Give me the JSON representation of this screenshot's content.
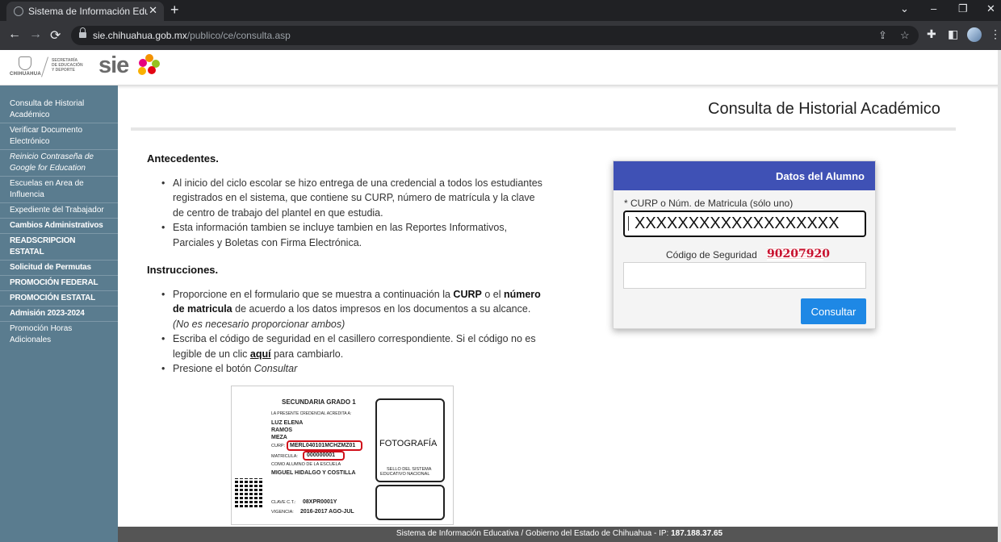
{
  "browser": {
    "tab_title": "Sistema de Información Educativa",
    "tab_close": "✕",
    "new_tab": "+",
    "window_controls": [
      "⌄",
      "–",
      "❐",
      "✕"
    ],
    "back": "←",
    "forward": "→",
    "reload": "⟳",
    "url_host": "sie.chihuahua.gob.mx",
    "url_path": "/publico/ce/consulta.asp",
    "colors": {
      "tabbar": "#202124",
      "toolbar": "#35363a"
    }
  },
  "header": {
    "gov_label": "CHIHUAHUA",
    "secretaria_lines": [
      "SECRETARÍA",
      "DE EDUCACIÓN",
      "Y DEPORTE"
    ],
    "sie_logo": "sie"
  },
  "sidebar": {
    "items": [
      {
        "label": "Consulta de Historial Académico"
      },
      {
        "label": "Verificar Documento Electrónico"
      },
      {
        "label": "Reinicio Contraseña de Google for Education"
      },
      {
        "label": "Escuelas en Area de Influencia"
      },
      {
        "label": "Expediente del Trabajador"
      },
      {
        "label": "Cambios Administrativos"
      },
      {
        "label": "READSCRIPCION ESTATAL"
      },
      {
        "label": "Solicitud de Permutas"
      },
      {
        "label": "PROMOCIÓN FEDERAL"
      },
      {
        "label": "PROMOCIÓN ESTATAL"
      },
      {
        "label": "Admisión 2023-2024"
      },
      {
        "label": "Promoción Horas Adicionales"
      }
    ],
    "color": "#5a7c8f"
  },
  "main": {
    "title": "Consulta de Historial Académico",
    "antecedentes_title": "Antecedentes.",
    "antecedentes": [
      "Al inicio del ciclo escolar se hizo entrega de una credencial a todos los estudiantes registrados en el sistema, que contiene su CURP, número de matrícula y la clave de centro de trabajo del plantel en que estudia.",
      "Esta información tambien se incluye tambien en las Reportes Informativos, Parciales y Boletas con Firma Electrónica."
    ],
    "instrucciones_title": "Instrucciones.",
    "instr1": {
      "a": "Proporcione en el formulario que se muestra a continuación la ",
      "b": "CURP",
      "c": " o el ",
      "d": "número de matricula",
      "e": " de acuerdo a los datos impresos en los documentos a su alcance. ",
      "f": "(No es necesario proporcionar ambos)"
    },
    "instr2": {
      "a": "Escriba el código de seguridad en el casillero correspondiente. Si el código no es legible de un clic ",
      "link": "aquí",
      "b": " para cambiarlo."
    },
    "instr3": {
      "a": "Presione el botón ",
      "b": "Consultar"
    }
  },
  "credential": {
    "grade": "SECUNDARIA GRADO 1",
    "intro": "LA PRESENTE CREDENCIAL ACREDITA A:",
    "name_lines": [
      "LUZ ELENA",
      "RAMOS",
      "MEZA"
    ],
    "curp_label": "CURP:",
    "curp": "MERL040101MCHZMZ01",
    "matricula_label": "MATRICULA:",
    "matricula": "000000001",
    "alumno_label": "COMO ALUMNO DE LA ESCUELA",
    "school": "MIGUEL HIDALGO Y COSTILLA",
    "photo_label": "FOTOGRAFÍA",
    "seal_lines": [
      "SELLO DEL SISTEMA",
      "EDUCATIVO NACIONAL"
    ],
    "ct_label": "CLAVE C.T.:",
    "ct": "08XPR0001Y",
    "vig_label": "VIGENCIA:",
    "vig": "2016-2017 AGO-JUL"
  },
  "form": {
    "title": "Datos del Alumno",
    "curp_label": "* CURP o Núm. de Matricula (sólo uno)",
    "curp_value": "XXXXXXXXXXXXXXXXXXX",
    "security_label": "Código de Seguridad",
    "captcha": "90207920",
    "security_value": "",
    "submit": "Consultar",
    "colors": {
      "header": "#3f51b5",
      "button": "#1e88e5"
    }
  },
  "footer": {
    "text": "Sistema de Información Educativa / Gobierno del Estado de Chihuahua - IP: ",
    "ip": "187.188.37.65"
  }
}
